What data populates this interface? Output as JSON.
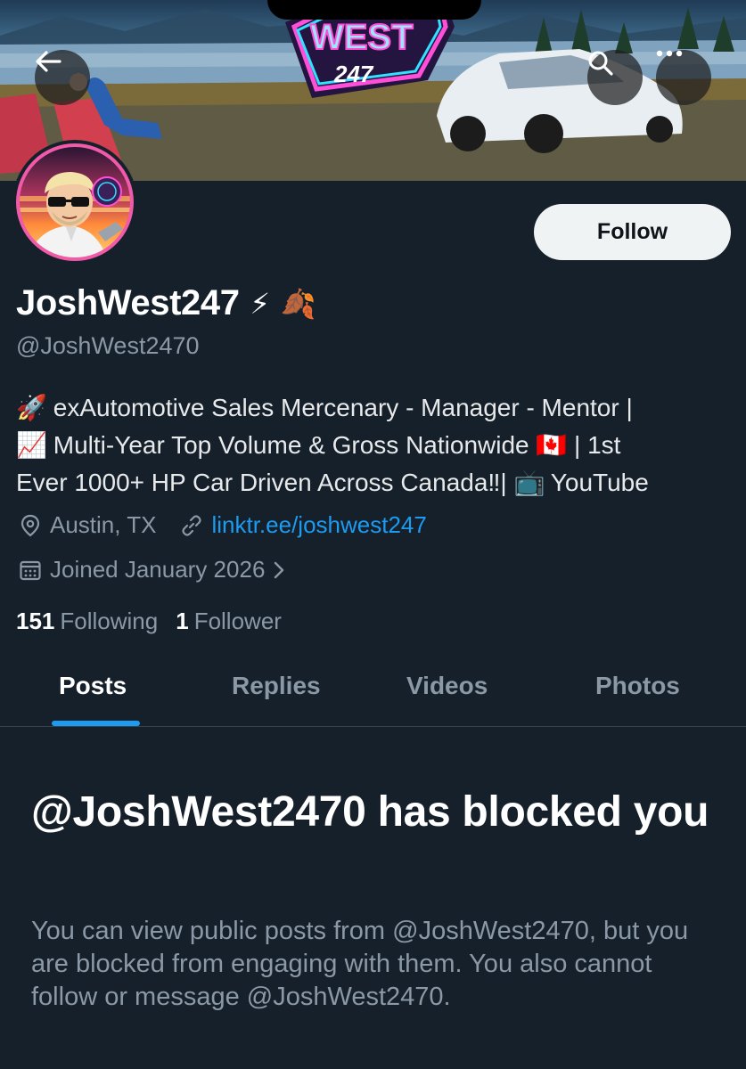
{
  "header": {
    "back_icon": "back-arrow-icon",
    "search_icon": "search-icon",
    "more_icon": "more-dots-icon",
    "banner_logo_text": "WEST",
    "banner_logo_number": "247"
  },
  "profile": {
    "display_name": "JoshWest247",
    "name_emojis": [
      "⚡",
      "🍂"
    ],
    "handle": "@JoshWest2470",
    "follow_label": "Follow",
    "bio": {
      "line1_emoji": "🚀",
      "line1_text": "exAutomotive Sales Mercenary - Manager - Mentor |",
      "line2_emoji": "📈",
      "line2_text": "Multi-Year Top Volume & Gross Nationwide",
      "line2_flag": "🇨🇦",
      "line2_tail": "| 1st",
      "line3_text": "Ever 1000+ HP Car Driven Across Canada‼|",
      "line3_emoji": "📺",
      "line3_tail": "YouTube"
    },
    "location": "Austin, TX",
    "link": "linktr.ee/joshwest247",
    "joined": "Joined January 2026",
    "following_count": "151",
    "following_label": "Following",
    "followers_count": "1",
    "followers_label": "Follower"
  },
  "tabs": [
    {
      "label": "Posts",
      "active": true
    },
    {
      "label": "Replies",
      "active": false
    },
    {
      "label": "Videos",
      "active": false
    },
    {
      "label": "Photos",
      "active": false
    }
  ],
  "blocked": {
    "title": "@JoshWest2470 has blocked you",
    "body": "You can view public posts from @JoshWest2470, but you are blocked from engaging with them. You also cannot follow or message @JoshWest2470."
  },
  "colors": {
    "background": "#15202b",
    "accent": "#1d9bf0",
    "secondary_text": "#8b98a5"
  }
}
